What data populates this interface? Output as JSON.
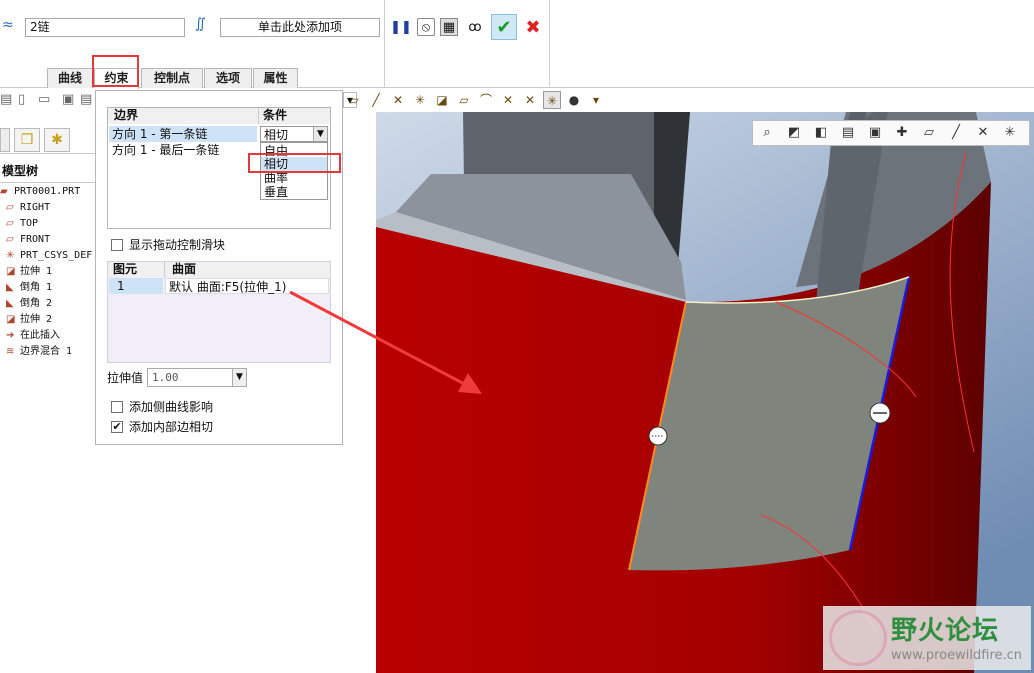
{
  "dashboard": {
    "chain_field_value": "2链",
    "add_item_field": "单击此处添加项",
    "tabs": [
      "曲线",
      "约束",
      "控制点",
      "选项",
      "属性"
    ],
    "active_tab": "约束",
    "buttons": [
      "pause-icon",
      "stop-icon",
      "preview-icon",
      "glasses-icon",
      "ok-check-icon",
      "cancel-x-icon"
    ]
  },
  "tree": {
    "title": "模型树",
    "items": [
      {
        "icon": "part-icon",
        "label": "PRT0001.PRT"
      },
      {
        "icon": "datum-plane-icon",
        "label": "RIGHT"
      },
      {
        "icon": "datum-plane-icon",
        "label": "TOP"
      },
      {
        "icon": "datum-plane-icon",
        "label": "FRONT"
      },
      {
        "icon": "csys-icon",
        "label": "PRT_CSYS_DEF"
      },
      {
        "icon": "extrude-icon",
        "label": "拉伸 1"
      },
      {
        "icon": "round-icon",
        "label": "倒角 1"
      },
      {
        "icon": "round-icon",
        "label": "倒角 2"
      },
      {
        "icon": "extrude-icon",
        "label": "拉伸 2"
      },
      {
        "icon": "insert-here-icon",
        "label": "在此插入"
      },
      {
        "icon": "boundary-blend-icon",
        "label": "边界混合 1"
      }
    ]
  },
  "constraints": {
    "col_boundary": "边界",
    "col_condition": "条件",
    "rows": [
      {
        "boundary": "方向 1 - 第一条链",
        "condition": "相切"
      },
      {
        "boundary": "方向 1 - 最后一条链",
        "condition": ""
      }
    ],
    "condition_options": [
      "自由",
      "相切",
      "曲率",
      "垂直"
    ],
    "highlighted_option": "相切",
    "show_drag_handles_label": "显示拖动控制滑块",
    "show_drag_handles_checked": false,
    "col_entity": "图元",
    "col_surface": "曲面",
    "surface_rows": [
      {
        "entity": "1",
        "surface": "默认 曲面:F5(拉伸_1)"
      }
    ],
    "stretch_label": "拉伸值",
    "stretch_value": "1.00",
    "add_side_curve_label": "添加侧曲线影响",
    "add_side_curve_checked": false,
    "add_inner_tangent_label": "添加内部边相切",
    "add_inner_tangent_checked": true
  },
  "watermark": {
    "title": "野火论坛",
    "url": "www.proewildfire.cn"
  }
}
